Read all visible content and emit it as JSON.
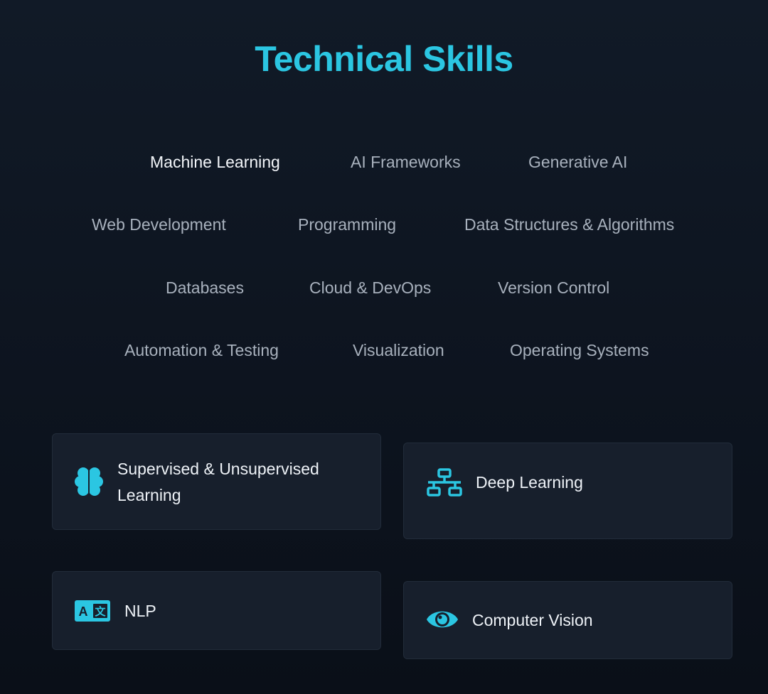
{
  "section": {
    "title": "Technical Skills"
  },
  "tabs": [
    {
      "label": "Machine Learning",
      "active": true
    },
    {
      "label": "AI Frameworks"
    },
    {
      "label": "Generative AI"
    },
    {
      "label": "Web Development"
    },
    {
      "label": "Programming"
    },
    {
      "label": "Data Structures & Algorithms"
    },
    {
      "label": "Databases"
    },
    {
      "label": "Cloud & DevOps"
    },
    {
      "label": "Version Control"
    },
    {
      "label": "Automation & Testing"
    },
    {
      "label": "Visualization"
    },
    {
      "label": "Operating Systems"
    }
  ],
  "cards": [
    {
      "line1": "Supervised & Unsupervised",
      "line2": "Learning",
      "icon": "brain-icon"
    },
    {
      "label": "Deep Learning",
      "icon": "network-icon"
    },
    {
      "label": "NLP",
      "icon": "translate-icon"
    },
    {
      "label": "Computer Vision",
      "icon": "eye-icon"
    }
  ],
  "colors": {
    "accent": "#2bc6e2",
    "background": "#0d141f",
    "card": "#171f2c"
  }
}
